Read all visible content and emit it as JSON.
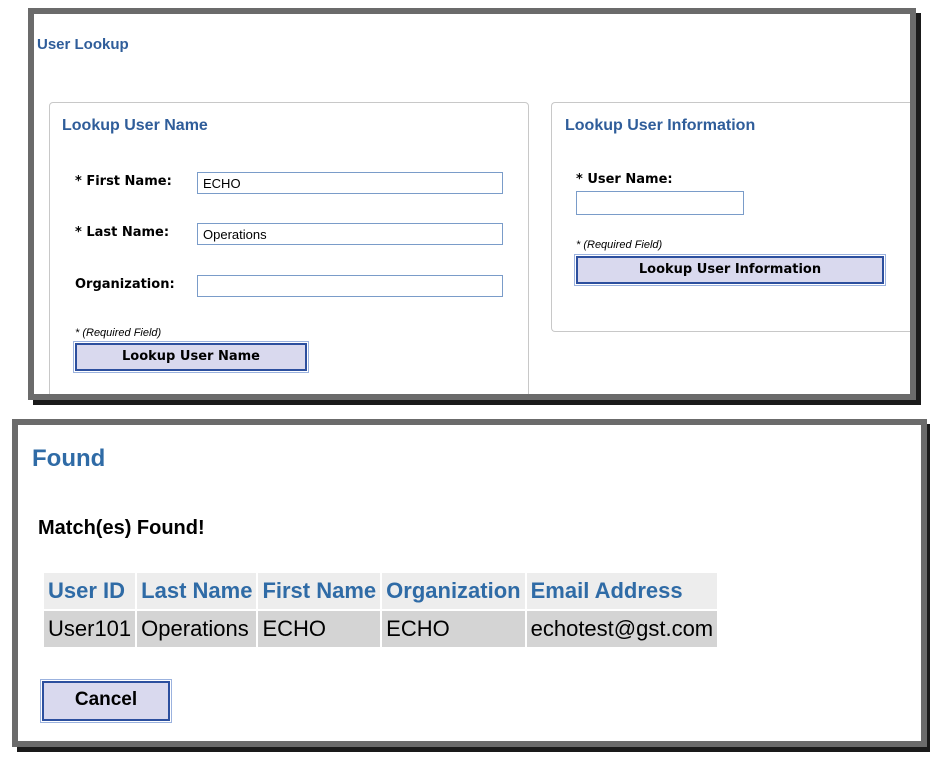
{
  "lookup": {
    "title": "User Lookup",
    "user_name_section": {
      "legend": "Lookup User Name",
      "first_name_label": "* First Name:",
      "first_name_value": "ECHO",
      "last_name_label": "* Last Name:",
      "last_name_value": "Operations",
      "organization_label": "Organization:",
      "organization_value": "",
      "required_note": "* (Required Field)",
      "button_label": "Lookup User Name"
    },
    "user_info_section": {
      "legend": "Lookup User Information",
      "user_name_label": "* User Name:",
      "user_name_value": "",
      "required_note": "* (Required Field)",
      "button_label": "Lookup User Information"
    }
  },
  "found": {
    "title": "Found",
    "message": "Match(es) Found!",
    "columns": [
      "User ID",
      "Last Name",
      "First Name",
      "Organization",
      "Email Address"
    ],
    "rows": [
      [
        "User101",
        "Operations",
        "ECHO",
        "ECHO",
        "echotest@gst.com"
      ]
    ],
    "cancel_label": "Cancel"
  }
}
